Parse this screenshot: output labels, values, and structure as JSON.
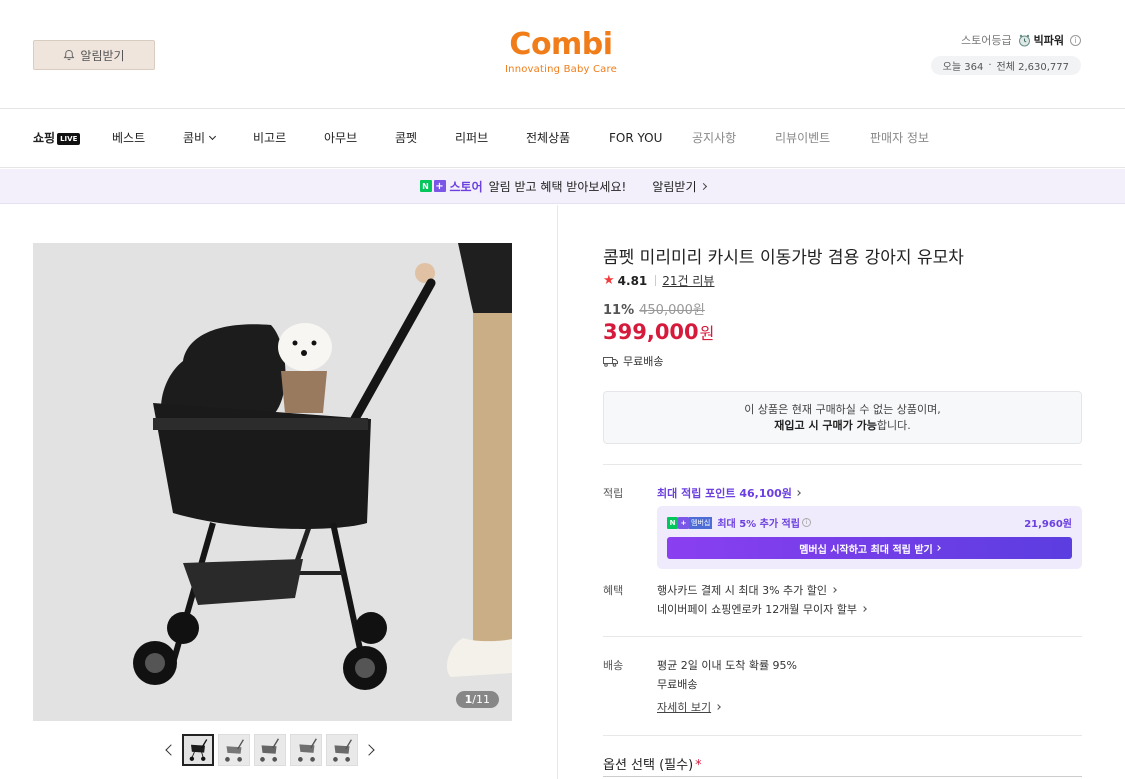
{
  "header": {
    "alarm_label": "알림받기",
    "logo_text": "Combi",
    "logo_tagline": "Innovating Baby Care",
    "store_grade_label": "스토어등급",
    "store_grade_value": "빅파워",
    "visitors_today": "오늘 364",
    "visitors_total": "전체 2,630,777"
  },
  "nav": {
    "items": [
      {
        "label": "쇼핑"
      },
      {
        "label": "베스트"
      },
      {
        "label": "콤비"
      },
      {
        "label": "비고르"
      },
      {
        "label": "아무브"
      },
      {
        "label": "콤펫"
      },
      {
        "label": "리퍼브"
      },
      {
        "label": "전체상품"
      },
      {
        "label": "FOR YOU"
      },
      {
        "label": "공지사항"
      },
      {
        "label": "리뷰이벤트"
      },
      {
        "label": "판매자 정보"
      }
    ],
    "live_badge": "LIVE"
  },
  "banner": {
    "store_label": "스토어",
    "message": "알림 받고 혜택 받아보세요!",
    "link_label": "알림받기"
  },
  "gallery": {
    "current": "1",
    "total": "/11",
    "thumb_count": 5
  },
  "product": {
    "title": "콤펫 미리미리 카시트 이동가방 겸용 강아지 유모차",
    "rating": "4.81",
    "review_count": "21건 리뷰",
    "discount_rate": "11%",
    "original_price": "450,000원",
    "price": "399,000",
    "price_unit": "원",
    "shipping_label": "무료배송",
    "soldout_line1": "이 상품은 현재 구매하실 수 없는 상품이며,",
    "soldout_line2_bold": "재입고 시 구매가 가능",
    "soldout_line2_rest": "합니다."
  },
  "points": {
    "label": "적립",
    "max_text": "최대 적립 포인트 46,100원",
    "membership_badge": "멤버십",
    "membership_text": "최대 5% 추가 적립",
    "membership_amount": "21,960원",
    "membership_button": "멤버십 시작하고 최대 적립 받기"
  },
  "benefits": {
    "label": "혜택",
    "line1": "행사카드 결제 시 최대 3% 추가 할인",
    "line2": "네이버페이 쇼핑엔로카 12개월 무이자 할부"
  },
  "delivery": {
    "label": "배송",
    "line1": "평균 2일 이내 도착 확률 95%",
    "line2": "무료배송",
    "detail_link": "자세히 보기"
  },
  "options": {
    "title": "옵션 선택 (필수)",
    "required_mark": "*"
  },
  "colors": {
    "brand_orange": "#f07d1a",
    "price_red": "#d61a3c",
    "naver_purple": "#6b3fe0",
    "naver_green": "#03c75a"
  }
}
